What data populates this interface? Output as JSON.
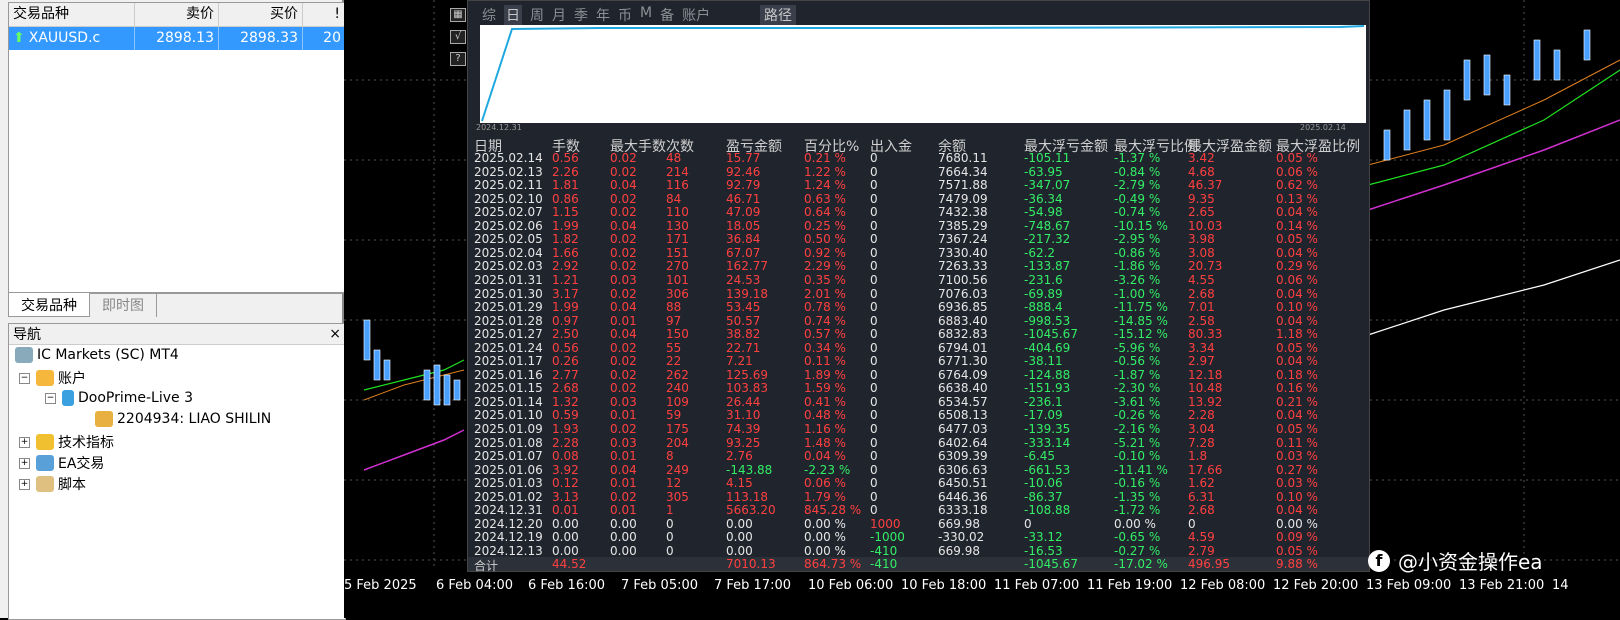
{
  "market_watch": {
    "headers": [
      "交易品种",
      "卖价",
      "买价",
      "!"
    ],
    "row": {
      "symbol": "XAUUSD.c",
      "bid": "2898.13",
      "ask": "2898.33",
      "spread": "20"
    },
    "tabs": [
      "交易品种",
      "即时图"
    ]
  },
  "navigator": {
    "title": "导航",
    "close": "×",
    "items": {
      "root": "IC Markets (SC) MT4",
      "accounts": "账户",
      "broker": "DooPrime-Live 3",
      "account": "2204934: LIAO SHILIN",
      "indicators": "技术指标",
      "ea": "EA交易",
      "scripts": "脚本"
    }
  },
  "overlay": {
    "tabs": [
      "综",
      "日",
      "周",
      "月",
      "季",
      "年",
      "币",
      "M",
      "备",
      "账户"
    ],
    "selected_tab": "日",
    "path": "路径",
    "equity_start": "2024.12.31",
    "equity_end": "2025.02.14",
    "columns": [
      "日期",
      "手数",
      "最大手数",
      "次数",
      "盈亏金额",
      "百分比%",
      "出入金",
      "余额",
      "最大浮亏金额",
      "最大浮亏比例",
      "最大浮盈金额",
      "最大浮盈比例"
    ],
    "rows": [
      [
        "2025.02.14",
        "0.56",
        "0.02",
        "48",
        "15.77",
        "0.21 %",
        "0",
        "7680.11",
        "-105.11",
        "-1.37 %",
        "3.42",
        "0.05 %"
      ],
      [
        "2025.02.13",
        "2.26",
        "0.02",
        "214",
        "92.46",
        "1.22 %",
        "0",
        "7664.34",
        "-63.95",
        "-0.84 %",
        "4.68",
        "0.06 %"
      ],
      [
        "2025.02.11",
        "1.81",
        "0.04",
        "116",
        "92.79",
        "1.24 %",
        "0",
        "7571.88",
        "-347.07",
        "-2.79 %",
        "46.37",
        "0.62 %"
      ],
      [
        "2025.02.10",
        "0.86",
        "0.02",
        "84",
        "46.71",
        "0.63 %",
        "0",
        "7479.09",
        "-36.34",
        "-0.49 %",
        "9.35",
        "0.13 %"
      ],
      [
        "2025.02.07",
        "1.15",
        "0.02",
        "110",
        "47.09",
        "0.64 %",
        "0",
        "7432.38",
        "-54.98",
        "-0.74 %",
        "2.65",
        "0.04 %"
      ],
      [
        "2025.02.06",
        "1.99",
        "0.04",
        "130",
        "18.05",
        "0.25 %",
        "0",
        "7385.29",
        "-748.67",
        "-10.15 %",
        "10.03",
        "0.14 %"
      ],
      [
        "2025.02.05",
        "1.82",
        "0.02",
        "171",
        "36.84",
        "0.50 %",
        "0",
        "7367.24",
        "-217.32",
        "-2.95 %",
        "3.98",
        "0.05 %"
      ],
      [
        "2025.02.04",
        "1.66",
        "0.02",
        "151",
        "67.07",
        "0.92 %",
        "0",
        "7330.40",
        "-62.2",
        "-0.86 %",
        "3.08",
        "0.04 %"
      ],
      [
        "2025.02.03",
        "2.92",
        "0.02",
        "270",
        "162.77",
        "2.29 %",
        "0",
        "7263.33",
        "-133.87",
        "-1.86 %",
        "20.73",
        "0.29 %"
      ],
      [
        "2025.01.31",
        "1.21",
        "0.03",
        "101",
        "24.53",
        "0.35 %",
        "0",
        "7100.56",
        "-231.6",
        "-3.26 %",
        "4.55",
        "0.06 %"
      ],
      [
        "2025.01.30",
        "3.17",
        "0.02",
        "306",
        "139.18",
        "2.01 %",
        "0",
        "7076.03",
        "-69.89",
        "-1.00 %",
        "2.68",
        "0.04 %"
      ],
      [
        "2025.01.29",
        "1.99",
        "0.04",
        "88",
        "53.45",
        "0.78 %",
        "0",
        "6936.85",
        "-888.4",
        "-11.75 %",
        "7.01",
        "0.10 %"
      ],
      [
        "2025.01.28",
        "0.97",
        "0.01",
        "97",
        "50.57",
        "0.74 %",
        "0",
        "6883.40",
        "-998.53",
        "-14.85 %",
        "2.58",
        "0.04 %"
      ],
      [
        "2025.01.27",
        "2.50",
        "0.04",
        "150",
        "38.82",
        "0.57 %",
        "0",
        "6832.83",
        "-1045.67",
        "-15.12 %",
        "80.33",
        "1.18 %"
      ],
      [
        "2025.01.24",
        "0.56",
        "0.02",
        "55",
        "22.71",
        "0.34 %",
        "0",
        "6794.01",
        "-404.69",
        "-5.96 %",
        "3.34",
        "0.05 %"
      ],
      [
        "2025.01.17",
        "0.26",
        "0.02",
        "22",
        "7.21",
        "0.11 %",
        "0",
        "6771.30",
        "-38.11",
        "-0.56 %",
        "2.97",
        "0.04 %"
      ],
      [
        "2025.01.16",
        "2.77",
        "0.02",
        "262",
        "125.69",
        "1.89 %",
        "0",
        "6764.09",
        "-124.88",
        "-1.87 %",
        "12.18",
        "0.18 %"
      ],
      [
        "2025.01.15",
        "2.68",
        "0.02",
        "240",
        "103.83",
        "1.59 %",
        "0",
        "6638.40",
        "-151.93",
        "-2.30 %",
        "10.48",
        "0.16 %"
      ],
      [
        "2025.01.14",
        "1.32",
        "0.03",
        "109",
        "26.44",
        "0.41 %",
        "0",
        "6534.57",
        "-236.1",
        "-3.61 %",
        "13.92",
        "0.21 %"
      ],
      [
        "2025.01.10",
        "0.59",
        "0.01",
        "59",
        "31.10",
        "0.48 %",
        "0",
        "6508.13",
        "-17.09",
        "-0.26 %",
        "2.28",
        "0.04 %"
      ],
      [
        "2025.01.09",
        "1.93",
        "0.02",
        "175",
        "74.39",
        "1.16 %",
        "0",
        "6477.03",
        "-139.35",
        "-2.16 %",
        "3.04",
        "0.05 %"
      ],
      [
        "2025.01.08",
        "2.28",
        "0.03",
        "204",
        "93.25",
        "1.48 %",
        "0",
        "6402.64",
        "-333.14",
        "-5.21 %",
        "7.28",
        "0.11 %"
      ],
      [
        "2025.01.07",
        "0.08",
        "0.01",
        "8",
        "2.76",
        "0.04 %",
        "0",
        "6309.39",
        "-6.45",
        "-0.10 %",
        "1.8",
        "0.03 %"
      ],
      [
        "2025.01.06",
        "3.92",
        "0.04",
        "249",
        "-143.88",
        "-2.23 %",
        "0",
        "6306.63",
        "-661.53",
        "-11.41 %",
        "17.66",
        "0.27 %"
      ],
      [
        "2025.01.03",
        "0.12",
        "0.01",
        "12",
        "4.15",
        "0.06 %",
        "0",
        "6450.51",
        "-10.06",
        "-0.16 %",
        "1.62",
        "0.03 %"
      ],
      [
        "2025.01.02",
        "3.13",
        "0.02",
        "305",
        "113.18",
        "1.79 %",
        "0",
        "6446.36",
        "-86.37",
        "-1.35 %",
        "6.31",
        "0.10 %"
      ],
      [
        "2024.12.31",
        "0.01",
        "0.01",
        "1",
        "5663.20",
        "845.28 %",
        "0",
        "6333.18",
        "-108.88",
        "-1.72 %",
        "2.68",
        "0.04 %"
      ],
      [
        "2024.12.20",
        "0.00",
        "0.00",
        "0",
        "0.00",
        "0.00 %",
        "1000",
        "669.98",
        "0",
        "0.00 %",
        "0",
        "0.00 %"
      ],
      [
        "2024.12.19",
        "0.00",
        "0.00",
        "0",
        "0.00",
        "0.00 %",
        "-1000",
        "-330.02",
        "-33.12",
        "-0.65 %",
        "4.59",
        "0.09 %"
      ],
      [
        "2024.12.13",
        "0.00",
        "0.00",
        "0",
        "0.00",
        "0.00 %",
        "-410",
        "669.98",
        "-16.53",
        "-0.27 %",
        "2.79",
        "0.05 %"
      ]
    ],
    "summary": [
      "合计",
      "44.52",
      "",
      "",
      "7010.13",
      "864.73 %",
      "-410",
      "",
      "-1045.67",
      "-17.02 %",
      "496.95",
      "9.88 %"
    ]
  },
  "time_axis": [
    "5 Feb 2025",
    "6 Feb 04:00",
    "6 Feb 16:00",
    "7 Feb 05:00",
    "7 Feb 17:00",
    "10 Feb 06:00",
    "10 Feb 18:00",
    "11 Feb 07:00",
    "11 Feb 19:00",
    "12 Feb 08:00",
    "12 Feb 20:00",
    "13 Feb 09:00",
    "13 Feb 21:00",
    "14"
  ],
  "watermark": "@小资金操作ea",
  "colors": {
    "red": "#ff4040",
    "green": "#33ee66",
    "accent": "#3399ff"
  }
}
